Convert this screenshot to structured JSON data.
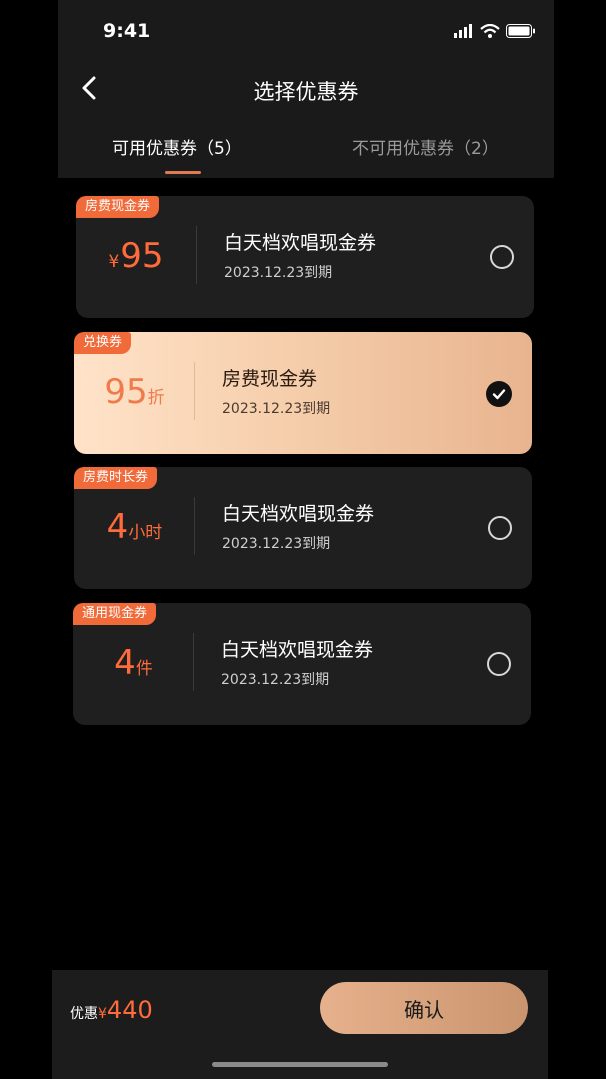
{
  "status": {
    "time": "9:41"
  },
  "header": {
    "title": "选择优惠券"
  },
  "tabs": [
    {
      "label": "可用优惠券（5）",
      "active": true
    },
    {
      "label": "不可用优惠券（2）",
      "active": false
    }
  ],
  "coupons": [
    {
      "tag": "房费现金券",
      "currency": "¥",
      "value": "95",
      "unit": "",
      "name": "白天档欢唱现金券",
      "expiry": "2023.12.23到期",
      "selected": false
    },
    {
      "tag": "兑换券",
      "currency": "",
      "value": "95",
      "unit": "折",
      "name": "房费现金券",
      "expiry": "2023.12.23到期",
      "selected": true
    },
    {
      "tag": "房费时长券",
      "currency": "",
      "value": "4",
      "unit": "小时",
      "name": "白天档欢唱现金券",
      "expiry": "2023.12.23到期",
      "selected": false
    },
    {
      "tag": "通用现金券",
      "currency": "",
      "value": "4",
      "unit": "件",
      "name": "白天档欢唱现金券",
      "expiry": "2023.12.23到期",
      "selected": false
    }
  ],
  "footer": {
    "discount_label": "优惠",
    "currency": "¥",
    "discount_amount": "440",
    "confirm_label": "确认"
  },
  "colors": {
    "accent": "#ff6b3a",
    "card_bg": "#1f1f1f",
    "selected_gradient_start": "#ffe3c9",
    "selected_gradient_end": "#e8b48f",
    "confirm_button": "#d9a47f"
  }
}
